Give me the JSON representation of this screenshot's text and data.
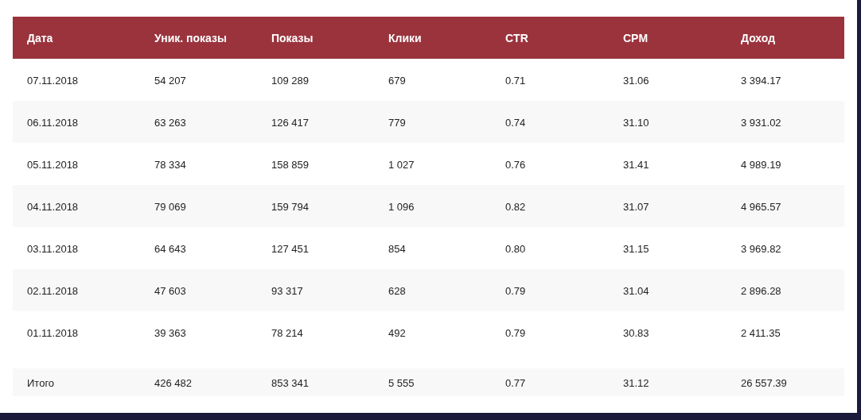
{
  "table": {
    "columns": [
      "Дата",
      "Уник. показы",
      "Показы",
      "Клики",
      "CTR",
      "CPM",
      "Доход"
    ],
    "rows": [
      [
        "07.11.2018",
        "54 207",
        "109 289",
        "679",
        "0.71",
        "31.06",
        "3 394.17"
      ],
      [
        "06.11.2018",
        "63 263",
        "126 417",
        "779",
        "0.74",
        "31.10",
        "3 931.02"
      ],
      [
        "05.11.2018",
        "78 334",
        "158 859",
        "1 027",
        "0.76",
        "31.41",
        "4 989.19"
      ],
      [
        "04.11.2018",
        "79 069",
        "159 794",
        "1 096",
        "0.82",
        "31.07",
        "4 965.57"
      ],
      [
        "03.11.2018",
        "64 643",
        "127 451",
        "854",
        "0.80",
        "31.15",
        "3 969.82"
      ],
      [
        "02.11.2018",
        "47 603",
        "93 317",
        "628",
        "0.79",
        "31.04",
        "2 896.28"
      ],
      [
        "01.11.2018",
        "39 363",
        "78 214",
        "492",
        "0.79",
        "30.83",
        "2 411.35"
      ]
    ],
    "total": [
      "Итого",
      "426 482",
      "853 341",
      "5 555",
      "0.77",
      "31.12",
      "26 557.39"
    ]
  }
}
